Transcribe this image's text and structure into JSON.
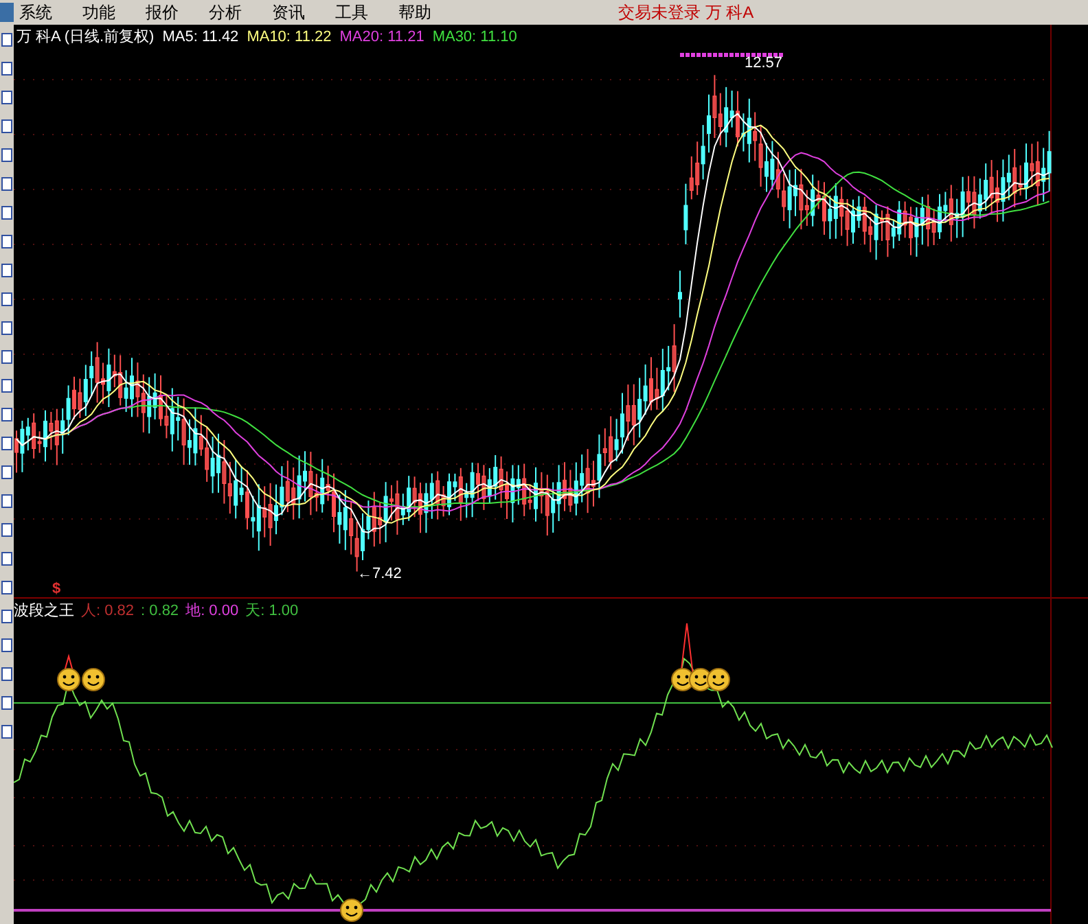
{
  "menu": {
    "items": [
      "系统",
      "功能",
      "报价",
      "分析",
      "资讯",
      "工具",
      "帮助"
    ],
    "status": "交易未登录 万 科A"
  },
  "price_panel": {
    "stock": "万 科A (日线.前复权)",
    "indicators": [
      {
        "label": "MA5: 11.42",
        "color": "#ffffff"
      },
      {
        "label": "MA10: 11.22",
        "color": "#ffff80"
      },
      {
        "label": "MA20: 11.21",
        "color": "#e040e0"
      },
      {
        "label": "MA30: 11.10",
        "color": "#40e040"
      }
    ],
    "high_label": "12.57",
    "low_label": "←7.42",
    "signal_mark": "$"
  },
  "oscillator_panel": {
    "name": "波段之王",
    "values": [
      {
        "label": "人: 0.82",
        "color": "#c03030"
      },
      {
        "label": ": 0.82",
        "color": "#40c040"
      },
      {
        "label": "地: 0.00",
        "color": "#e040e0"
      },
      {
        "label": "天: 1.00",
        "color": "#40c040"
      }
    ]
  }
}
